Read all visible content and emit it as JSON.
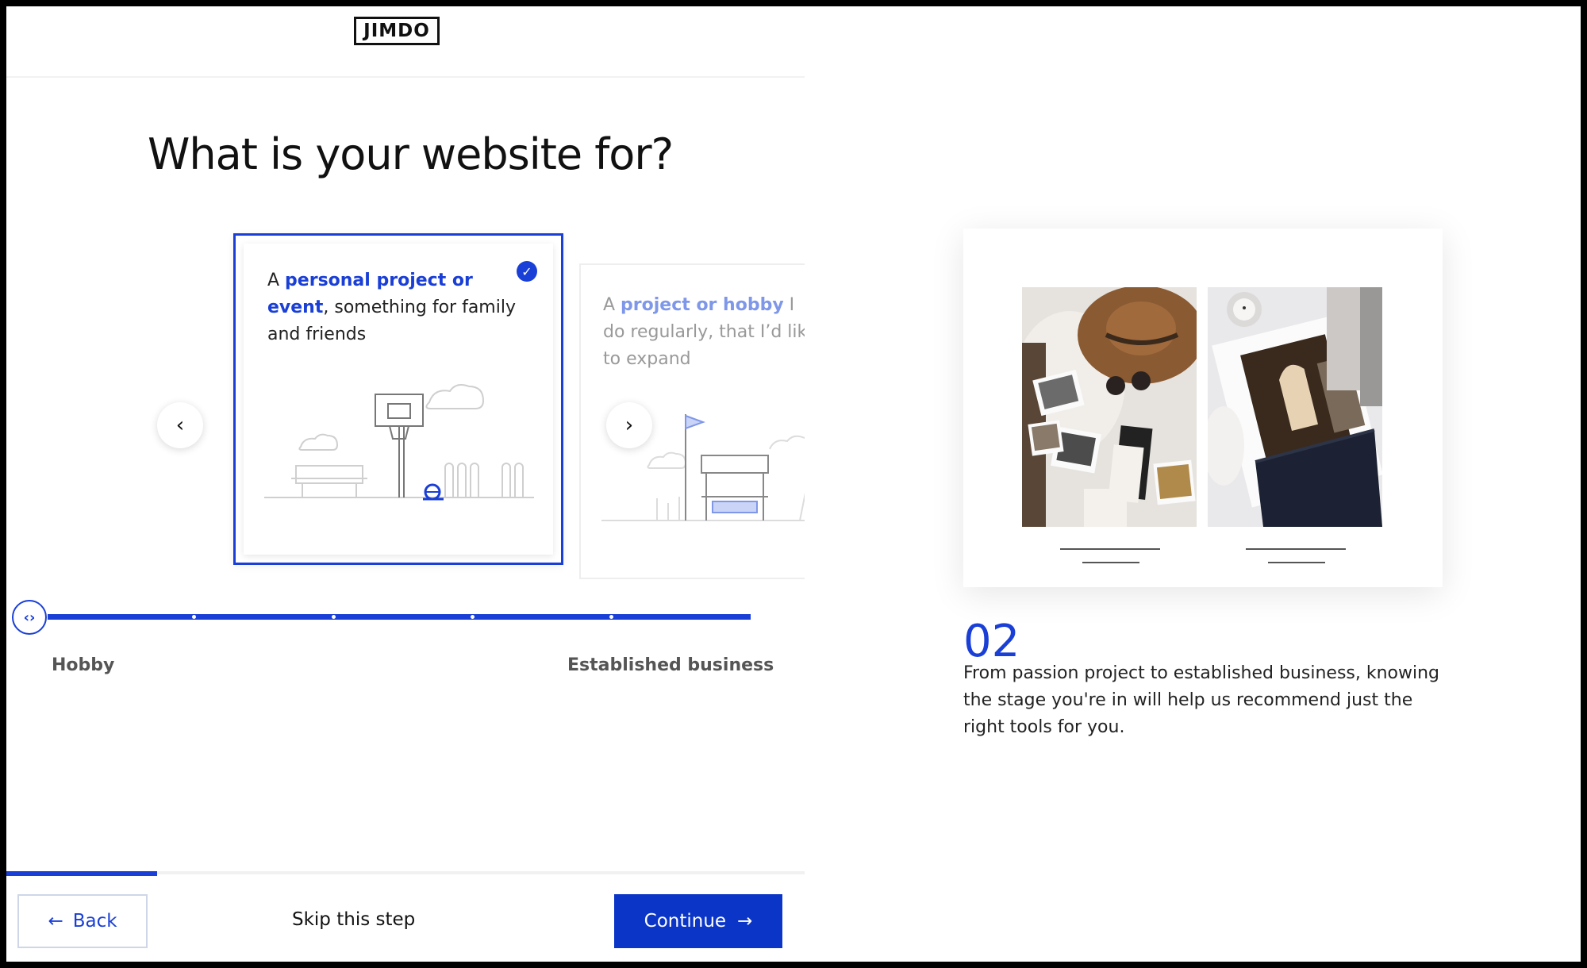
{
  "header": {
    "logo": "JIMDO"
  },
  "question": {
    "title": "What is your website for?"
  },
  "cards": [
    {
      "prefix": "A ",
      "highlight": "personal project or event",
      "suffix": ", something for family and friends",
      "selected": true
    },
    {
      "prefix": "A ",
      "highlight": "project or hobby",
      "suffix": " I do regularly, that I’d like to expand",
      "selected": false
    }
  ],
  "slider": {
    "left_label": "Hobby",
    "right_label": "Established business",
    "position": 0,
    "steps": 6
  },
  "progress": {
    "fraction": 0.19
  },
  "footer": {
    "back_label": "Back",
    "skip_label": "Skip this step",
    "continue_label": "Continue"
  },
  "info": {
    "step_number": "02",
    "description": "From passion project to established business, knowing the stage you're in will help us recommend just the right tools for you."
  },
  "colors": {
    "accent": "#1a3fd6",
    "button": "#0a35c7"
  }
}
